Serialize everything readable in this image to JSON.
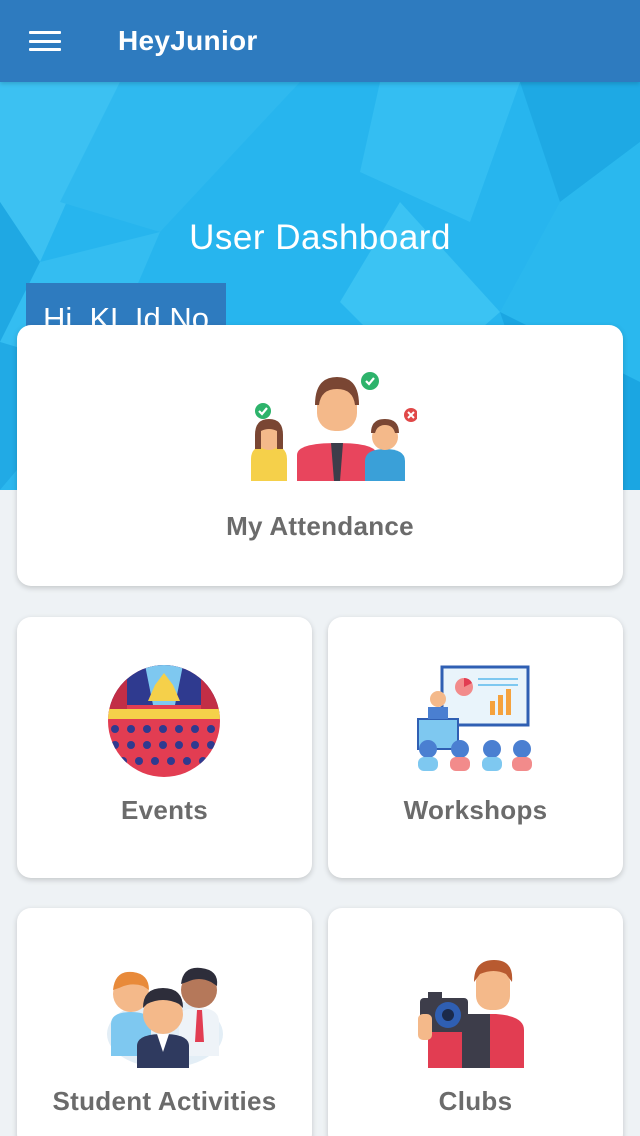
{
  "appbar": {
    "title": "HeyJunior",
    "menu_icon": "hamburger-menu-icon"
  },
  "hero": {
    "title": "User Dashboard",
    "greeting": "Hi, KL Id No",
    "colors": {
      "background": "#27b5ee",
      "bar": "#2e7bbf"
    }
  },
  "cards": {
    "attendance": {
      "label": "My Attendance",
      "icon": "attendance-people-icon"
    },
    "events": {
      "label": "Events",
      "icon": "theater-stage-icon"
    },
    "workshops": {
      "label": "Workshops",
      "icon": "presentation-board-icon"
    },
    "student_activities": {
      "label": "Student Activities",
      "icon": "student-group-icon"
    },
    "clubs": {
      "label": "Clubs",
      "icon": "photographer-camera-icon"
    }
  }
}
